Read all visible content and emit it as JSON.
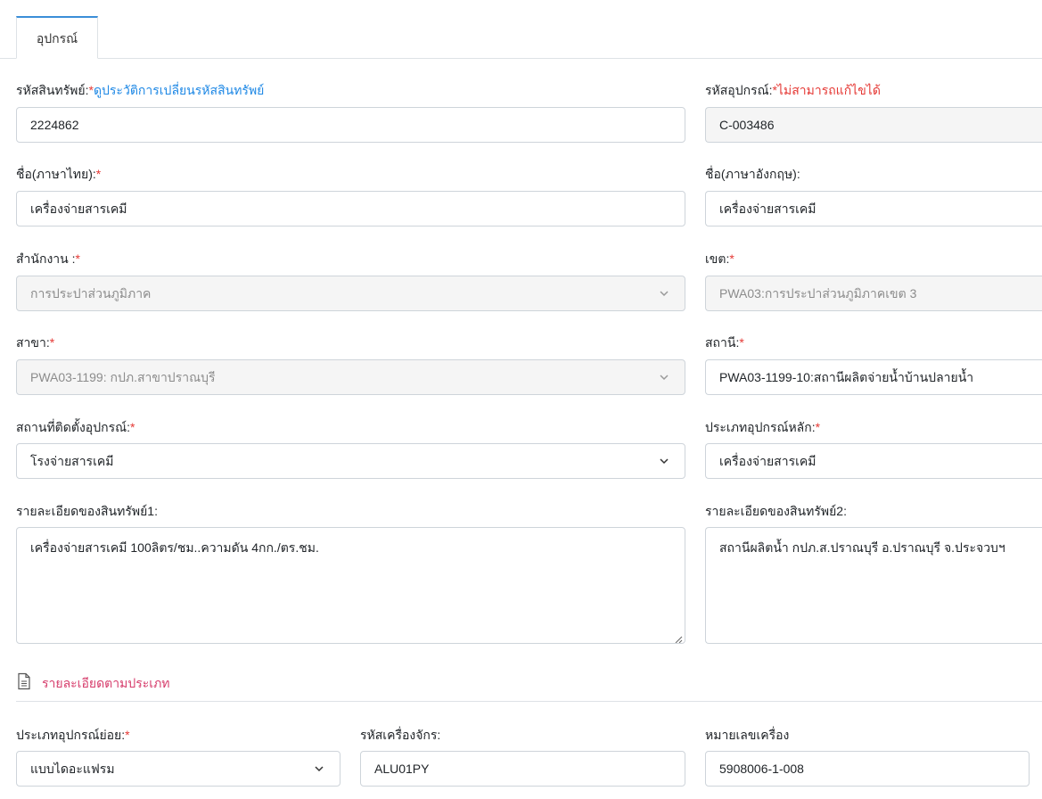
{
  "tabs": [
    {
      "label": "อุปกรณ์"
    }
  ],
  "form": {
    "asset_code": {
      "label": "รหัสสินทรัพย์:",
      "required": "*",
      "link": "ดูประวัติการเปลี่ยนรหัสสินทรัพย์",
      "value": "2224862"
    },
    "equipment_code": {
      "label": "รหัสอุปกรณ์:",
      "required": "*",
      "note": "ไม่สามารถแก้ไขได้",
      "value": "C-003486"
    },
    "name_th": {
      "label": "ชื่อ(ภาษาไทย):",
      "required": "*",
      "value": "เครื่องจ่ายสารเคมี"
    },
    "name_en": {
      "label": "ชื่อ(ภาษาอังกฤษ):",
      "value": "เครื่องจ่ายสารเคมี"
    },
    "office": {
      "label": "สำนักงาน :",
      "required": "*",
      "value": "การประปาส่วนภูมิภาค"
    },
    "zone": {
      "label": "เขต:",
      "required": "*",
      "value": "PWA03:การประปาส่วนภูมิภาคเขต 3"
    },
    "branch": {
      "label": "สาขา:",
      "required": "*",
      "value": "PWA03-1199: กปภ.สาขาปราณบุรี"
    },
    "station": {
      "label": "สถานี:",
      "required": "*",
      "value": "PWA03-1199-10:สถานีผลิตจ่ายน้ำบ้านปลายน้ำ"
    },
    "install_location": {
      "label": "สถานที่ติดตั้งอุปกรณ์:",
      "required": "*",
      "value": "โรงจ่ายสารเคมี"
    },
    "main_type": {
      "label": "ประเภทอุปกรณ์หลัก:",
      "required": "*",
      "value": "เครื่องจ่ายสารเคมี"
    },
    "detail1": {
      "label": "รายละเอียดของสินทรัพย์1:",
      "value": "เครื่องจ่ายสารเคมี 100ลิตร/ชม..ความดัน 4กก./ตร.ชม."
    },
    "detail2": {
      "label": "รายละเอียดของสินทรัพย์2:",
      "value": "สถานีผลิตน้ำ กปภ.ส.ปราณบุรี อ.ปราณบุรี จ.ประจวบฯ"
    }
  },
  "section": {
    "title": "รายละเอียดตามประเภท",
    "icon": "document-icon",
    "color": "#d63c6b"
  },
  "type_form": {
    "sub_type": {
      "label": "ประเภทอุปกรณ์ย่อย:",
      "required": "*",
      "value": "แบบไดอะแฟรม"
    },
    "machine_code": {
      "label": "รหัสเครื่องจักร:",
      "value": "ALU01PY"
    },
    "serial_number": {
      "label": "หมายเลขเครื่อง",
      "value": "5908006-1-008"
    }
  },
  "colors": {
    "accent": "#3b8ed8",
    "link": "#1e88e5",
    "required": "#e53935"
  }
}
